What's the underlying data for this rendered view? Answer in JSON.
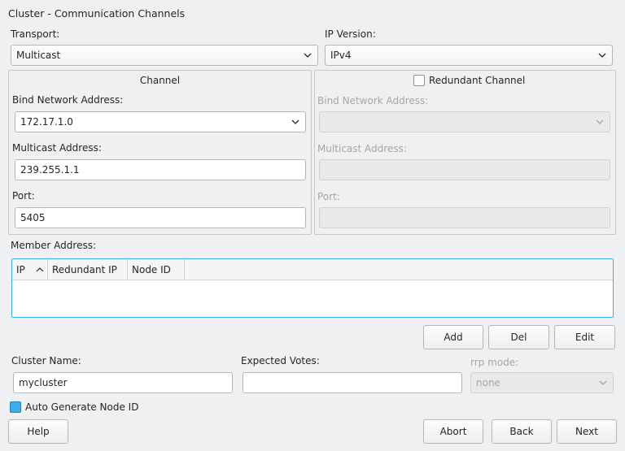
{
  "window": {
    "title": "Cluster - Communication Channels"
  },
  "transport": {
    "label": "Transport:",
    "value": "Multicast"
  },
  "ip_version": {
    "label": "IP Version:",
    "value": "IPv4"
  },
  "channel": {
    "title": "Channel",
    "bind_label": "Bind Network Address:",
    "bind_value": "172.17.1.0",
    "mcast_label": "Multicast Address:",
    "mcast_value": "239.255.1.1",
    "port_label": "Port:",
    "port_value": "5405"
  },
  "redundant": {
    "title": "Redundant Channel",
    "checked": false,
    "bind_label": "Bind Network Address:",
    "mcast_label": "Multicast Address:",
    "port_label": "Port:"
  },
  "members": {
    "label": "Member Address:",
    "columns": [
      "IP",
      "Redundant IP",
      "Node ID"
    ],
    "sort_column": "IP",
    "rows": []
  },
  "member_buttons": {
    "add": "Add",
    "del": "Del",
    "edit": "Edit"
  },
  "cluster_name": {
    "label": "Cluster Name:",
    "value": "mycluster"
  },
  "expected_votes": {
    "label": "Expected Votes:",
    "value": ""
  },
  "rrp_mode": {
    "label": "rrp mode:",
    "value": "none"
  },
  "auto_node_id": {
    "label": "Auto Generate Node ID",
    "checked": true
  },
  "footer": {
    "help": "Help",
    "abort": "Abort",
    "back": "Back",
    "next": "Next"
  },
  "colors": {
    "accent": "#3daee9",
    "window_bg": "#eff0f1",
    "disabled_text": "#a4a6a8"
  }
}
